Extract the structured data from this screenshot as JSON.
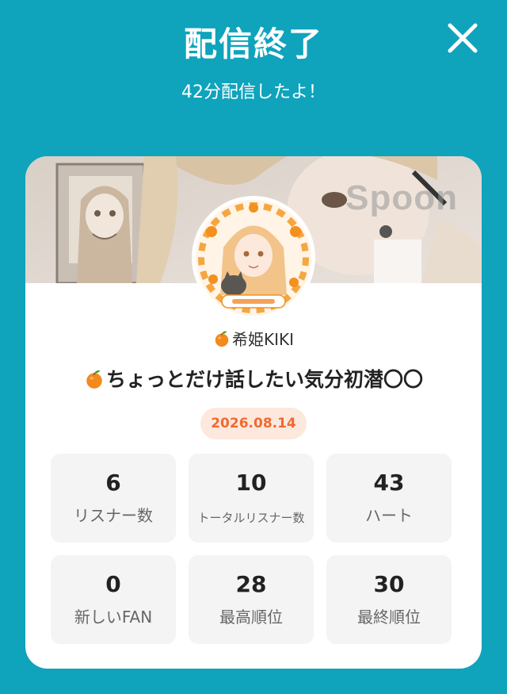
{
  "header": {
    "title": "配信終了",
    "subtitle": "42分配信したよ！",
    "close_icon": "close-icon"
  },
  "banner": {
    "watermark": "Spoon"
  },
  "profile": {
    "username": "希姫KIKI",
    "username_icon": "tangerine-icon",
    "stream_title": "ちょっとだけ話したい気分初潜〇〇",
    "stream_title_icon": "tangerine-icon",
    "date": "2026.08.14"
  },
  "stats": [
    {
      "value": "6",
      "label": "リスナー数"
    },
    {
      "value": "10",
      "label": "トータルリスナー数"
    },
    {
      "value": "43",
      "label": "ハート"
    },
    {
      "value": "0",
      "label": "新しいFAN"
    },
    {
      "value": "28",
      "label": "最高順位"
    },
    {
      "value": "30",
      "label": "最終順位"
    }
  ],
  "colors": {
    "background": "#0fa3bc",
    "card": "#ffffff",
    "date_badge_bg": "#fde8de",
    "date_badge_text": "#f06a30",
    "stat_bg": "#f4f4f4"
  }
}
